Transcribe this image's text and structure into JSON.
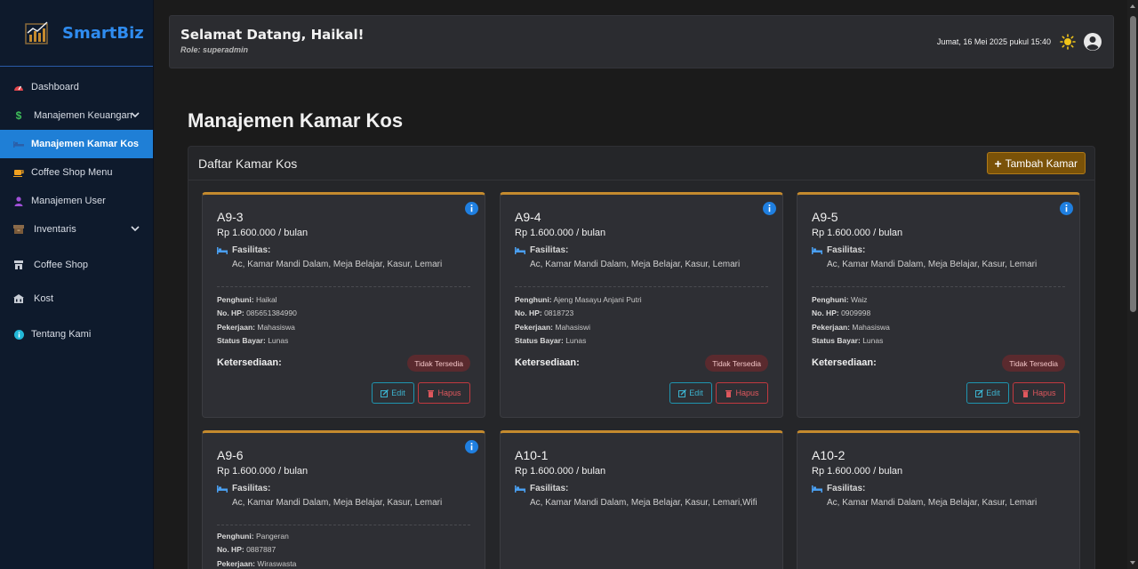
{
  "brand": {
    "name": "SmartBiz"
  },
  "sidebar": {
    "items": [
      {
        "label": "Dashboard",
        "icon": "gauge-icon"
      },
      {
        "label": "Manajemen Keuangan",
        "icon": "dollar-icon"
      },
      {
        "label": "Manajemen Kamar Kos",
        "icon": "bed-icon"
      },
      {
        "label": "Coffee Shop Menu",
        "icon": "coffee-icon"
      },
      {
        "label": "Manajemen User",
        "icon": "user-icon"
      },
      {
        "label": "Inventaris",
        "icon": "box-icon"
      },
      {
        "label": "Coffee Shop",
        "icon": "store-icon"
      },
      {
        "label": "Kost",
        "icon": "building-icon"
      },
      {
        "label": "Tentang Kami",
        "icon": "info-icon"
      }
    ]
  },
  "header": {
    "welcome": "Selamat Datang, Haikal!",
    "role": "Role: superadmin",
    "datetime": "Jumat, 16 Mei 2025 pukul 15:40"
  },
  "page": {
    "title": "Manajemen Kamar Kos",
    "panel_title": "Daftar Kamar Kos",
    "add_button": "Tambah Kamar"
  },
  "labels": {
    "facilities": "Fasilitas:",
    "occupant": "Penghuni:",
    "phone": "No. HP:",
    "job": "Pekerjaan:",
    "payment": "Status Bayar:",
    "availability": "Ketersediaan:",
    "edit": "Edit",
    "delete": "Hapus"
  },
  "rooms": [
    {
      "code": "A9-3",
      "price": "Rp 1.600.000 / bulan",
      "facilities": "Ac, Kamar Mandi Dalam, Meja Belajar, Kasur, Lemari",
      "occupant": "Haikal",
      "phone": "085651384990",
      "job": "Mahasiswa",
      "payment": "Lunas",
      "status": "Tidak Tersedia"
    },
    {
      "code": "A9-4",
      "price": "Rp 1.600.000 / bulan",
      "facilities": "Ac, Kamar Mandi Dalam, Meja Belajar, Kasur, Lemari",
      "occupant": "Ajeng Masayu Anjani Putri",
      "phone": "0818723",
      "job": "Mahasiswi",
      "payment": "Lunas",
      "status": "Tidak Tersedia"
    },
    {
      "code": "A9-5",
      "price": "Rp 1.600.000 / bulan",
      "facilities": "Ac, Kamar Mandi Dalam, Meja Belajar, Kasur, Lemari",
      "occupant": "Waiz",
      "phone": "0909998",
      "job": "Mahasiswa",
      "payment": "Lunas",
      "status": "Tidak Tersedia"
    },
    {
      "code": "A9-6",
      "price": "Rp 1.600.000 / bulan",
      "facilities": "Ac, Kamar Mandi Dalam, Meja Belajar, Kasur, Lemari",
      "occupant": "Pangeran",
      "phone": "0887887",
      "job": "Wiraswasta"
    },
    {
      "code": "A10-1",
      "price": "Rp 1.600.000 / bulan",
      "facilities": "Ac, Kamar Mandi Dalam, Meja Belajar, Kasur, Lemari,Wifi"
    },
    {
      "code": "A10-2",
      "price": "Rp 1.600.000 / bulan",
      "facilities": "Ac, Kamar Mandi Dalam, Meja Belajar, Kasur, Lemari"
    }
  ],
  "colors": {
    "accent": "#1f7fd6",
    "card_top": "#c48a2e",
    "add_button": "#7a5208",
    "badge": "#5a2a2e"
  }
}
